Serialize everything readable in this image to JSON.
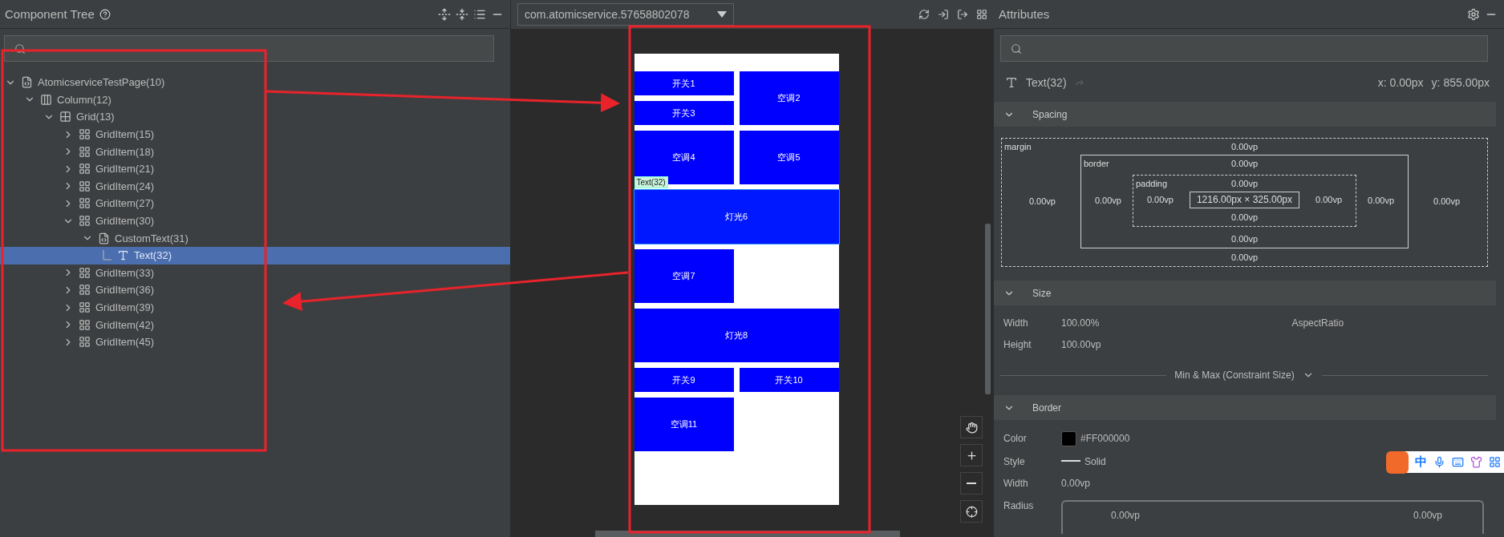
{
  "component_tree": {
    "title": "Component Tree",
    "nodes": [
      {
        "label": "AtomicserviceTestPage(10)",
        "kind": "page",
        "expanded": true,
        "selected": false,
        "children": [
          {
            "label": "Column(12)",
            "kind": "column",
            "expanded": true,
            "selected": false,
            "children": [
              {
                "label": "Grid(13)",
                "kind": "grid",
                "expanded": true,
                "selected": false,
                "children": [
                  {
                    "label": "GridItem(15)",
                    "kind": "griditem",
                    "expanded": false,
                    "selected": false
                  },
                  {
                    "label": "GridItem(18)",
                    "kind": "griditem",
                    "expanded": false,
                    "selected": false
                  },
                  {
                    "label": "GridItem(21)",
                    "kind": "griditem",
                    "expanded": false,
                    "selected": false
                  },
                  {
                    "label": "GridItem(24)",
                    "kind": "griditem",
                    "expanded": false,
                    "selected": false
                  },
                  {
                    "label": "GridItem(27)",
                    "kind": "griditem",
                    "expanded": false,
                    "selected": false
                  },
                  {
                    "label": "GridItem(30)",
                    "kind": "griditem",
                    "expanded": true,
                    "selected": false,
                    "children": [
                      {
                        "label": "CustomText(31)",
                        "kind": "page",
                        "expanded": true,
                        "selected": false,
                        "children": [
                          {
                            "label": "Text(32)",
                            "kind": "text",
                            "selected": true
                          }
                        ]
                      }
                    ]
                  },
                  {
                    "label": "GridItem(33)",
                    "kind": "griditem",
                    "expanded": false,
                    "selected": false
                  },
                  {
                    "label": "GridItem(36)",
                    "kind": "griditem",
                    "expanded": false,
                    "selected": false
                  },
                  {
                    "label": "GridItem(39)",
                    "kind": "griditem",
                    "expanded": false,
                    "selected": false
                  },
                  {
                    "label": "GridItem(42)",
                    "kind": "griditem",
                    "expanded": false,
                    "selected": false
                  },
                  {
                    "label": "GridItem(45)",
                    "kind": "griditem",
                    "expanded": false,
                    "selected": false
                  }
                ]
              }
            ]
          }
        ]
      }
    ]
  },
  "preview": {
    "device": "com.atomicservice.57658802078",
    "selection_tag": "Text(32)",
    "tiles": [
      {
        "label": "开关1",
        "kind": "half",
        "selected": false
      },
      {
        "label": "空调2",
        "kind": "tall",
        "selected": false
      },
      {
        "label": "开关3",
        "kind": "half",
        "selected": false
      },
      {
        "label": "空调4",
        "kind": "tall",
        "selected": false
      },
      {
        "label": "空调5",
        "kind": "tall",
        "selected": false
      },
      {
        "label": "灯光6",
        "kind": "wide",
        "selected": true
      },
      {
        "label": "空调7",
        "kind": "tall",
        "selected": false
      },
      {
        "label": "灯光8",
        "kind": "wide",
        "selected": false
      },
      {
        "label": "开关9",
        "kind": "half",
        "selected": false
      },
      {
        "label": "开关10",
        "kind": "half",
        "selected": false
      },
      {
        "label": "空调11",
        "kind": "tall",
        "selected": false
      }
    ]
  },
  "attributes": {
    "title": "Attributes",
    "component": {
      "name": "Text(32)",
      "x": "x: 0.00px",
      "y": "y: 855.00px"
    },
    "spacing": {
      "title": "Spacing",
      "expanded": true,
      "margin": {
        "label": "margin",
        "top": "0.00vp",
        "left": "0.00vp",
        "right": "0.00vp",
        "bottom": "0.00vp"
      },
      "border": {
        "label": "border",
        "top": "0.00vp",
        "left": "0.00vp",
        "right": "0.00vp",
        "bottom": "0.00vp"
      },
      "padding": {
        "label": "padding",
        "top": "0.00vp",
        "left": "0.00vp",
        "right": "0.00vp",
        "bottom": "0.00vp"
      },
      "content": "1216.00px × 325.00px"
    },
    "size": {
      "title": "Size",
      "expanded": true,
      "rows": [
        {
          "label": "Width",
          "value": "100.00%"
        },
        {
          "label": "Height",
          "value": "100.00vp"
        }
      ],
      "aspect_label": "AspectRatio",
      "constraint": "Min & Max (Constraint Size)"
    },
    "border": {
      "title": "Border",
      "expanded": true,
      "color": {
        "label": "Color",
        "value": "#FF000000",
        "color": "#000000"
      },
      "style": {
        "label": "Style",
        "value": "Solid"
      },
      "width": {
        "label": "Width",
        "value": "0.00vp"
      },
      "radius": {
        "label": "Radius",
        "top_left": "0.00vp",
        "top_right": "0.00vp"
      }
    }
  },
  "ime_bar": {
    "mode": "中"
  }
}
